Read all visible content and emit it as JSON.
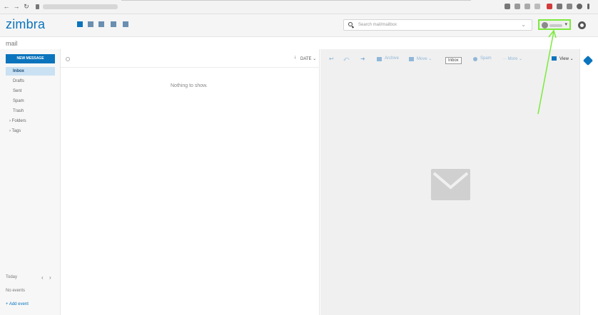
{
  "browser": {
    "back_icon": "arrow-left",
    "forward_icon": "arrow-right",
    "reload_icon": "refresh",
    "lock_icon": "lock"
  },
  "header": {
    "logo": "zimbra",
    "app_icons": [
      "mail-icon",
      "calendar-icon",
      "briefcase-icon",
      "chat-icon",
      "tasks-icon"
    ],
    "search_placeholder": "Search mail/mailbox",
    "search_chevron": "⌄",
    "user_caret": "▾",
    "settings_icon": "gear"
  },
  "breadcrumb": "mail",
  "sidebar": {
    "new_message": "NEW MESSAGE",
    "folders": [
      "Inbox",
      "Drafts",
      "Sent",
      "Spam",
      "Trash"
    ],
    "groups": [
      "› Folders",
      "› Tags"
    ],
    "calendar": {
      "today": "Today",
      "prev": "‹",
      "next": "›",
      "no_events": "No events",
      "add_event": "+ Add event"
    }
  },
  "list": {
    "sort_arrow": "↓",
    "sort_label": "DATE ⌄",
    "empty": "Nothing to show."
  },
  "toolbar": {
    "reply_icon": "↩",
    "reply_all_icon": "⤺",
    "forward_icon": "➜",
    "archive": "Archive",
    "move": "Move ⌄",
    "spam": "Spam",
    "more": "··· More ⌄",
    "tooltip": "Inbox",
    "view": "View ⌄"
  },
  "colors": {
    "accent": "#0b74bd",
    "annotation": "#7bea3c"
  }
}
